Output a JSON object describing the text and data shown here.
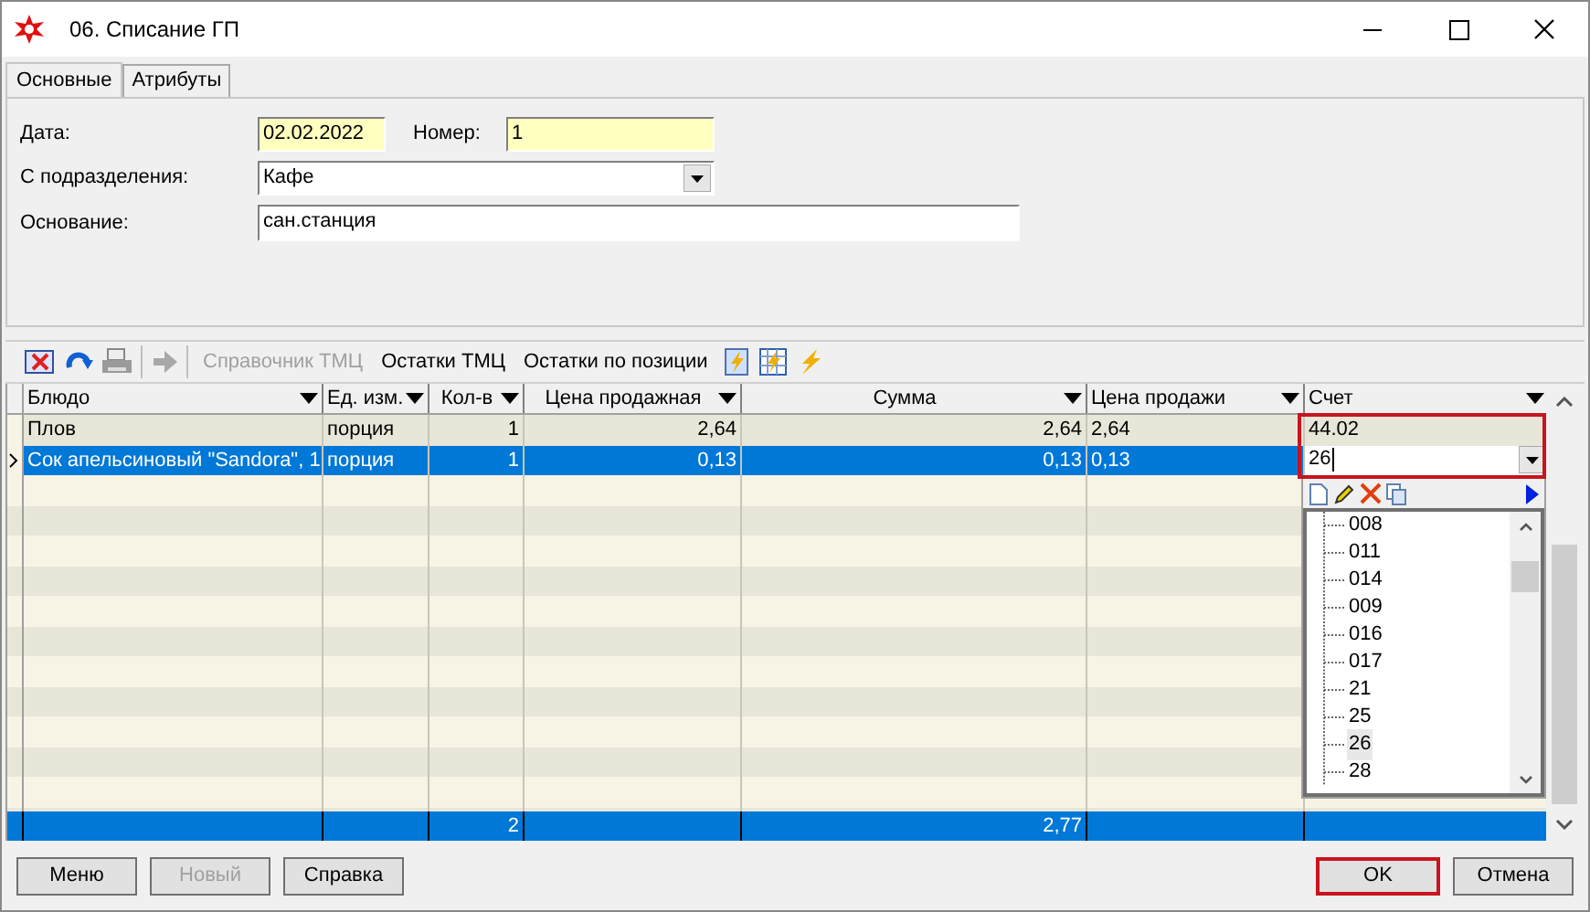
{
  "window": {
    "title": "06. Списание ГП"
  },
  "tabs": [
    {
      "label": "Основные",
      "selected": true
    },
    {
      "label": "Атрибуты",
      "selected": false
    }
  ],
  "form": {
    "date": {
      "label": "Дата:",
      "value": "02.02.2022"
    },
    "number": {
      "label": "Номер:",
      "value": "1"
    },
    "department": {
      "label": "С подразделения:",
      "value": "Кафе"
    },
    "basis": {
      "label": "Основание:",
      "value": "сан.станция"
    }
  },
  "toolbar": [
    {
      "label": "Справочник ТМЦ",
      "disabled": true
    },
    {
      "label": "Остатки ТМЦ",
      "disabled": false
    },
    {
      "label": "Остатки по позиции",
      "disabled": false
    }
  ],
  "table": {
    "columns": [
      "Блюдо",
      "Ед. изм.",
      "Кол-в",
      "Цена продажная",
      "Сумма",
      "Цена продажи",
      "Счет"
    ],
    "rows": [
      {
        "cells": [
          "Плов",
          "порция",
          "1",
          "2,64",
          "2,64",
          "2,64",
          "44.02"
        ],
        "selected": false,
        "editing": false
      },
      {
        "cells": [
          "Сок апельсиновый \"Sandora\", 1",
          "порция",
          "1",
          "0,13",
          "0,13",
          "0,13",
          "26"
        ],
        "selected": true,
        "editing": true
      }
    ],
    "totals": {
      "quantity": "2",
      "sum": "2,77"
    }
  },
  "account_list": [
    {
      "label": "008",
      "selected": false
    },
    {
      "label": "011",
      "selected": false
    },
    {
      "label": "014",
      "selected": false
    },
    {
      "label": "009",
      "selected": false
    },
    {
      "label": "016",
      "selected": false
    },
    {
      "label": "017",
      "selected": false
    },
    {
      "label": "21",
      "selected": false
    },
    {
      "label": "25",
      "selected": false
    },
    {
      "label": "26",
      "selected": true
    },
    {
      "label": "28",
      "selected": false
    }
  ],
  "buttons": [
    {
      "label": "Меню",
      "disabled": false,
      "focused": false
    },
    {
      "label": "Новый",
      "disabled": true,
      "focused": false
    },
    {
      "label": "Справка",
      "disabled": false,
      "focused": false
    },
    {
      "label": "OK",
      "disabled": false,
      "focused": true
    },
    {
      "label": "Отмена",
      "disabled": false,
      "focused": false
    }
  ]
}
